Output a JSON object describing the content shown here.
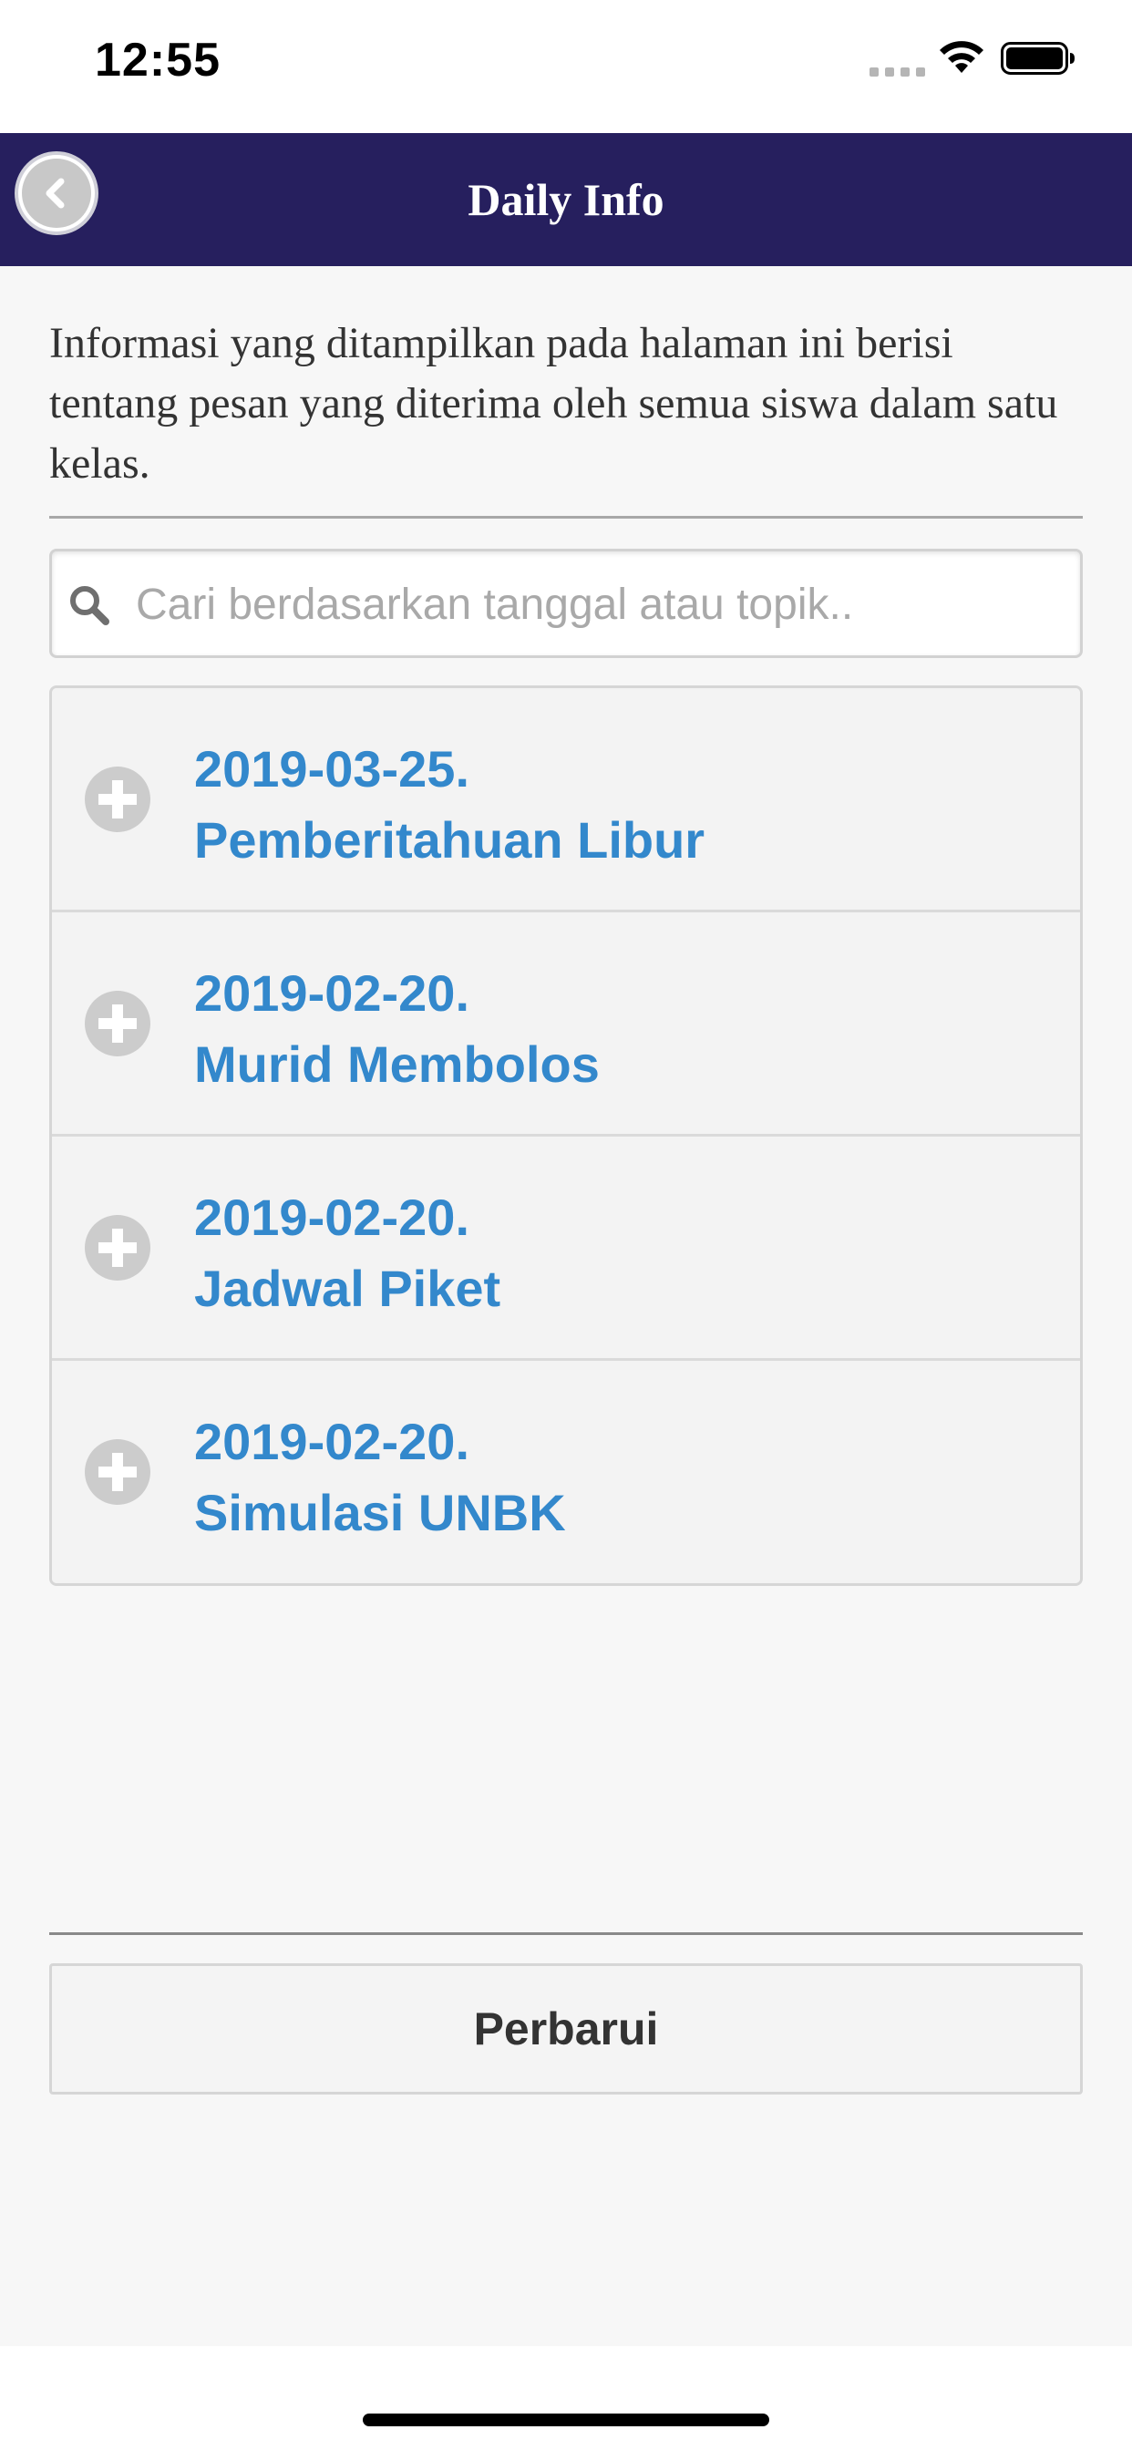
{
  "status_bar": {
    "time": "12:55"
  },
  "header": {
    "title": "Daily Info",
    "back_icon": "chevron-left-icon"
  },
  "intro": {
    "text": "Informasi yang ditampilkan pada halaman ini berisi tentang pesan yang diterima oleh semua siswa dalam satu kelas."
  },
  "search": {
    "placeholder": "Cari berdasarkan tanggal atau topik..",
    "value": "",
    "icon": "search-icon"
  },
  "items": [
    {
      "date": "2019-03-25.",
      "topic": "Pemberitahuan Libur"
    },
    {
      "date": "2019-02-20.",
      "topic": "Murid Membolos"
    },
    {
      "date": "2019-02-20.",
      "topic": "Jadwal Piket"
    },
    {
      "date": "2019-02-20.",
      "topic": "Simulasi UNBK"
    }
  ],
  "refresh_button": {
    "label": "Perbarui"
  },
  "colors": {
    "header_bg": "#261f5e",
    "link": "#3388cc",
    "icon_gray": "#c8c8c8"
  }
}
